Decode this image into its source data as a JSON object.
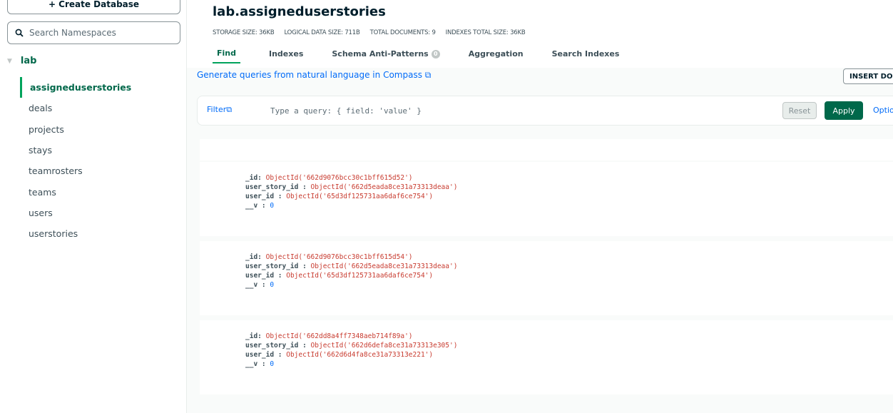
{
  "sidebar": {
    "create_database_label": "+ Create Database",
    "search_placeholder": "Search Namespaces",
    "database": "lab",
    "collections": [
      "assigneduserstories",
      "deals",
      "projects",
      "stays",
      "teamrosters",
      "teams",
      "users",
      "userstories"
    ],
    "active_collection": "assigneduserstories"
  },
  "header": {
    "title": "lab.assigneduserstories",
    "stats": {
      "storage": "STORAGE SIZE: 36KB",
      "logical": "LOGICAL DATA SIZE: 711B",
      "documents": "TOTAL DOCUMENTS: 9",
      "indexes": "INDEXES TOTAL SIZE: 36KB"
    },
    "tabs": {
      "find": "Find",
      "indexes": "Indexes",
      "schema": "Schema Anti-Patterns",
      "schema_badge": "0",
      "aggregation": "Aggregation",
      "search_indexes": "Search Indexes"
    }
  },
  "nl_link": "Generate queries from natural language in Compass",
  "insert_button": "INSERT DOCUMENT",
  "filter": {
    "label": "Filter",
    "placeholder": "Type a query: { field: 'value' }",
    "reset": "Reset",
    "apply": "Apply",
    "options": "Options"
  },
  "documents": [
    {
      "id": "ObjectId('662d9076bcc30c1bff615d52')",
      "user_story_id": "ObjectId('662d5eada8ce31a73313deaa')",
      "user_id": "ObjectId('65d3df125731aa6daf6ce754')",
      "v": "0"
    },
    {
      "id": "ObjectId('662d9076bcc30c1bff615d54')",
      "user_story_id": "ObjectId('662d5eada8ce31a73313deaa')",
      "user_id": "ObjectId('65d3df125731aa6daf6ce754')",
      "v": "0"
    },
    {
      "id": "ObjectId('662dd8a4ff7348aeb714f89a')",
      "user_story_id": "ObjectId('662d6defa8ce31a73313e305')",
      "user_id": "ObjectId('662d6d4fa8ce31a73313e221')",
      "v": "0"
    }
  ],
  "field_names": {
    "id": "_id:",
    "user_story_id": "user_story_id :",
    "user_id": "user_id :",
    "v": "__v :"
  }
}
